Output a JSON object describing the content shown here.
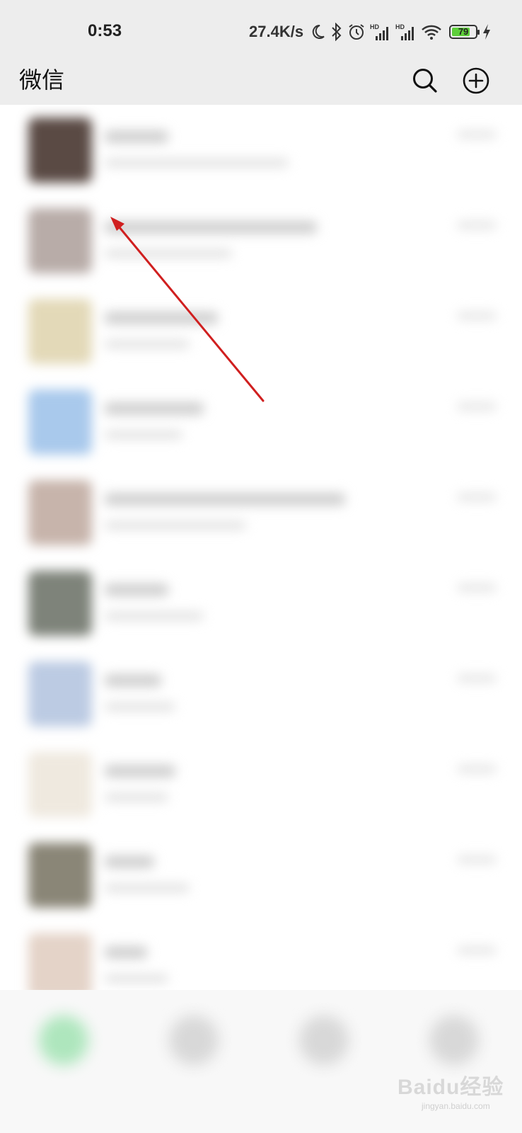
{
  "status_bar": {
    "time": "0:53",
    "net_speed": "27.4K/s",
    "icons": [
      "moon-icon",
      "bluetooth-icon",
      "alarm-icon",
      "hd-signal-icon",
      "hd-signal-icon",
      "wifi-icon",
      "battery-icon",
      "charging-icon"
    ],
    "battery_level": "79",
    "battery_fraction": 0.79
  },
  "header": {
    "title": "微信",
    "actions": [
      "search-icon",
      "plus-circle-icon"
    ]
  },
  "chat_list": {
    "blurred": true,
    "rows": [
      {
        "avatar_color": "#5a4a44"
      },
      {
        "avatar_color": "#b8aca8"
      },
      {
        "avatar_color": "#e3d9b8"
      },
      {
        "avatar_color": "#a9c9ec"
      },
      {
        "avatar_color": "#c7b4ab"
      },
      {
        "avatar_color": "#7e837a"
      },
      {
        "avatar_color": "#bccbe3"
      },
      {
        "avatar_color": "#efe9df"
      },
      {
        "avatar_color": "#8a8677"
      },
      {
        "avatar_color": "#e4d3c8"
      }
    ]
  },
  "bottom_nav": {
    "blurred": true,
    "tab_colors": [
      "#aee6bd",
      "#d8d8d8",
      "#d8d8d8",
      "#d8d8d8"
    ]
  },
  "annotation": {
    "arrow_color": "#d01f1f"
  },
  "watermark": {
    "text": "Baidu经验",
    "sub": "jingyan.baidu.com"
  }
}
